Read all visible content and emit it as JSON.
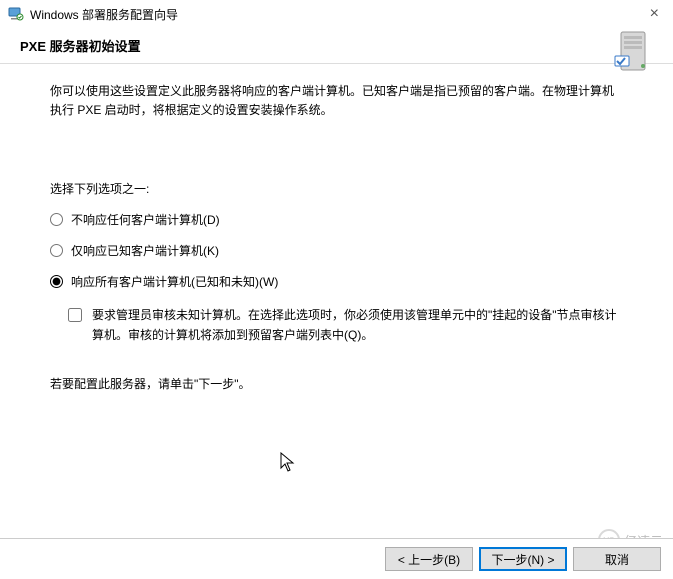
{
  "window": {
    "title": "Windows 部署服务配置向导"
  },
  "header": {
    "title": "PXE 服务器初始设置"
  },
  "description": "你可以使用这些设置定义此服务器将响应的客户端计算机。已知客户端是指已预留的客户端。在物理计算机执行 PXE 启动时，将根据定义的设置安装操作系统。",
  "prompt": "选择下列选项之一:",
  "options": {
    "opt_none": "不响应任何客户端计算机(D)",
    "opt_known": "仅响应已知客户端计算机(K)",
    "opt_all": "响应所有客户端计算机(已知和未知)(W)"
  },
  "checkbox_label": "要求管理员审核未知计算机。在选择此选项时，你必须使用该管理单元中的\"挂起的设备\"节点审核计算机。审核的计算机将添加到预留客户端列表中(Q)。",
  "footer_hint": "若要配置此服务器，请单击\"下一步\"。",
  "buttons": {
    "back": "< 上一步(B)",
    "next": "下一步(N) >",
    "cancel": "取消"
  },
  "watermark": "亿速云"
}
